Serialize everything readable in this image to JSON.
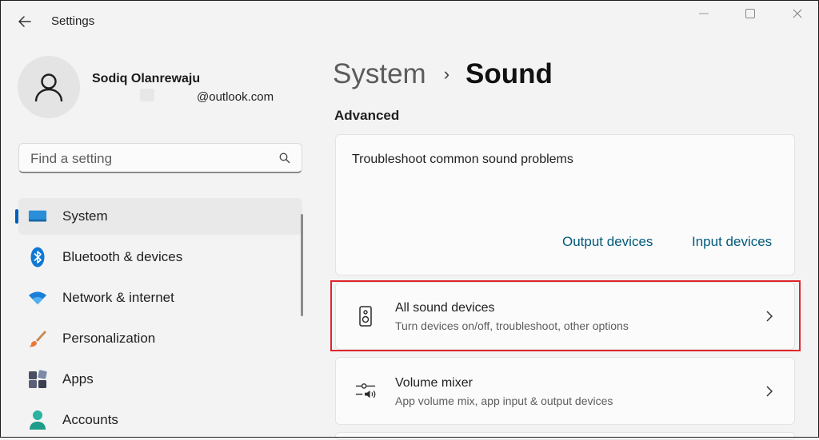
{
  "window": {
    "title": "Settings"
  },
  "profile": {
    "name": "Sodiq Olanrewaju",
    "email": "@outlook.com"
  },
  "search": {
    "placeholder": "Find a setting"
  },
  "nav": {
    "items": [
      {
        "label": "System",
        "icon": "monitor-icon",
        "selected": true
      },
      {
        "label": "Bluetooth & devices",
        "icon": "bluetooth-icon"
      },
      {
        "label": "Network & internet",
        "icon": "wifi-icon"
      },
      {
        "label": "Personalization",
        "icon": "paintbrush-icon"
      },
      {
        "label": "Apps",
        "icon": "apps-icon"
      },
      {
        "label": "Accounts",
        "icon": "accounts-icon"
      }
    ]
  },
  "breadcrumb": {
    "parent": "System",
    "separator": "›",
    "current": "Sound"
  },
  "section": {
    "label": "Advanced"
  },
  "troubleshoot": {
    "title": "Troubleshoot common sound problems",
    "output_label": "Output devices",
    "input_label": "Input devices"
  },
  "all_sound_devices": {
    "title": "All sound devices",
    "subtitle": "Turn devices on/off, troubleshoot, other options",
    "icon": "speaker-icon"
  },
  "volume_mixer": {
    "title": "Volume mixer",
    "subtitle": "App volume mix, app input & output devices",
    "icon": "mixer-icon"
  },
  "colors": {
    "accent": "#005fb8",
    "link": "#005a7a",
    "highlight": "#e0242a",
    "background": "#f3f3f3",
    "card": "#fbfbfb"
  }
}
